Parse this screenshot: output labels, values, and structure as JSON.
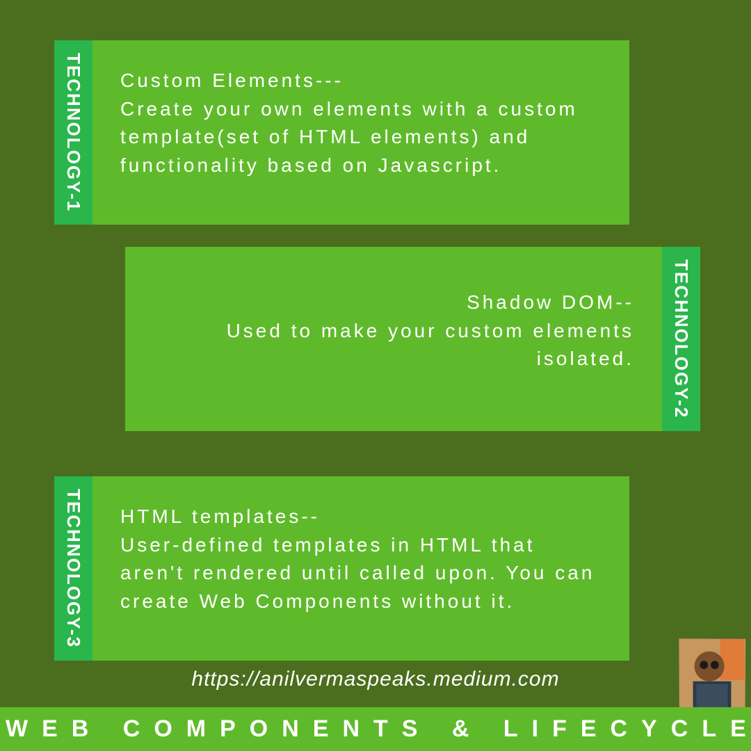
{
  "card1": {
    "tab": "TECHNOLOGY-1",
    "title": "Custom Elements---",
    "text": "Create your own elements with a custom template(set of HTML elements) and functionality based on Javascript."
  },
  "card2": {
    "tab": "TECHNOLOGY-2",
    "title": "Shadow DOM--",
    "text": "Used to make your custom elements isolated."
  },
  "card3": {
    "tab": "TECHNOLOGY-3",
    "title": "HTML templates--",
    "text": "User-defined templates in HTML that aren't rendered until called upon. You can create Web Components without it."
  },
  "url": "https://anilvermaspeaks.medium.com",
  "footer": "WEB COMPONENTS & LIFECYCLE"
}
